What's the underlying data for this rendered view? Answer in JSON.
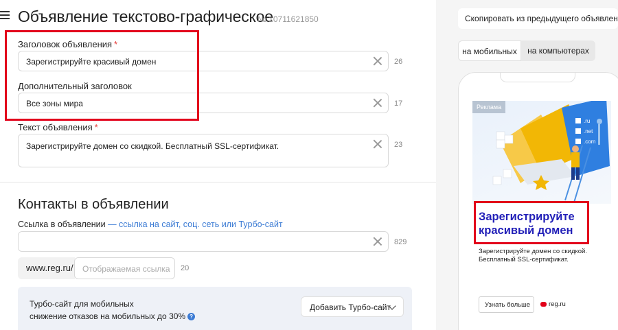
{
  "header": {
    "title": "Объявление текстово-графическое",
    "ad_number": "№ 10711621850"
  },
  "fields": {
    "headline": {
      "label": "Заголовок объявления",
      "required": "*",
      "value": "Зарегистрируйте красивый домен",
      "count": "26"
    },
    "subheadline": {
      "label": "Дополнительный заголовок",
      "value": "Все зоны мира",
      "count": "17"
    },
    "text": {
      "label": "Текст объявления",
      "required": "*",
      "value": "Зарегистрируйте домен со скидкой. Бесплатный SSL-сертификат.",
      "count": "23"
    }
  },
  "contacts": {
    "title": "Контакты в объявлении",
    "link_label": "Ссылка в объявлении",
    "link_hint": "— ссылка на сайт, соц. сеть или Турбо-сайт",
    "link_value": "",
    "link_count": "829",
    "domain": "www.reg.ru/",
    "display_placeholder": "Отображаемая ссылка",
    "display_count": "20"
  },
  "turbo": {
    "line1": "Турбо-сайт для мобильных",
    "line2": "снижение отказов на мобильных до 30%",
    "help_glyph": "?",
    "button": "Добавить Турбо-сайт"
  },
  "preview": {
    "copy_button": "Скопировать из предыдущего объявления",
    "tabs": [
      "на мобильных",
      "на компьютерах"
    ],
    "ad_label": "Реклама",
    "headline": "Зарегистрируйте красивый домен",
    "description": "Зарегистрируйте домен со скидкой. Бесплатный SSL-сертификат.",
    "cta": "Узнать больше",
    "site": "reg.ru",
    "illustration_tags": [
      ".ru",
      ".net",
      ".com"
    ]
  },
  "colors": {
    "accent_red": "#e2001a",
    "link_blue": "#3b7bd4",
    "headline_blue": "#2220b8"
  }
}
